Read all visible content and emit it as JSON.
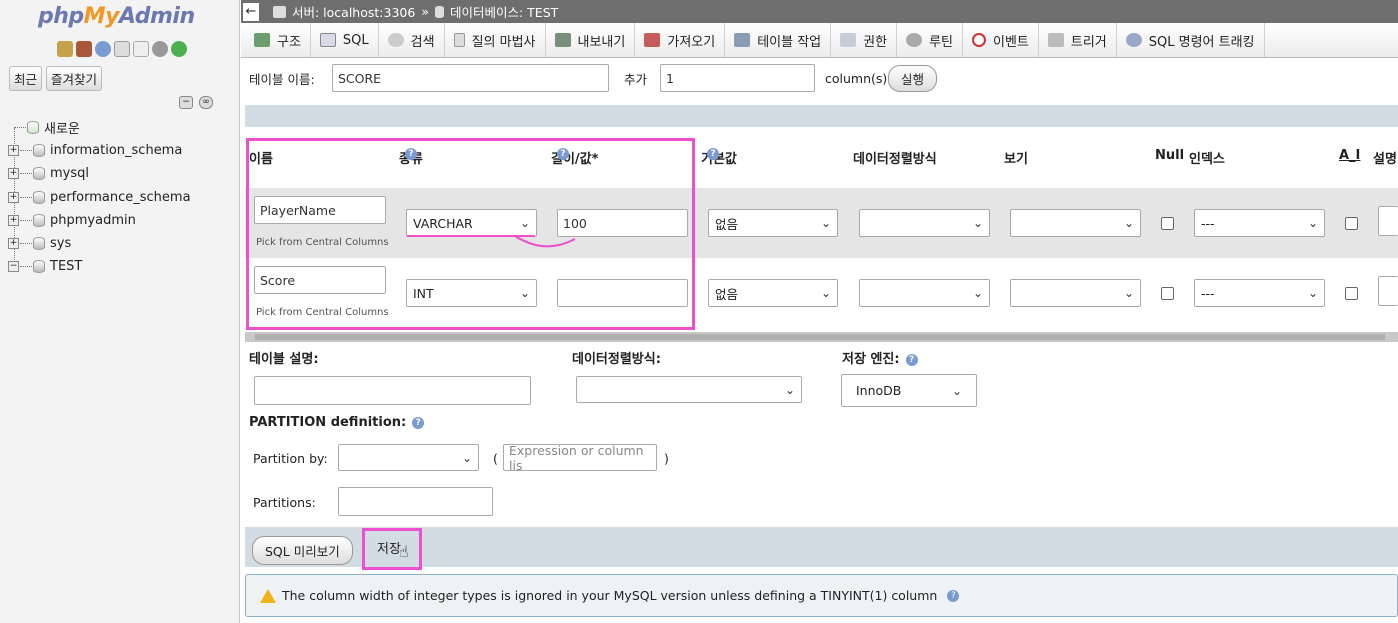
{
  "sidebar": {
    "logo": {
      "php": "php",
      "my": "My",
      "admin": "Admin"
    },
    "tabs": [
      "최근",
      "즐겨찾기"
    ],
    "tree": [
      {
        "label": "새로운",
        "expander": ""
      },
      {
        "label": "information_schema",
        "expander": "+"
      },
      {
        "label": "mysql",
        "expander": "+"
      },
      {
        "label": "performance_schema",
        "expander": "+"
      },
      {
        "label": "phpmyadmin",
        "expander": "+"
      },
      {
        "label": "sys",
        "expander": "+"
      },
      {
        "label": "TEST",
        "expander": "−"
      }
    ]
  },
  "breadcrumb": {
    "back": "←",
    "server": "서버: localhost:3306",
    "sep": "»",
    "database": "데이터베이스: TEST"
  },
  "tabs": [
    "구조",
    "SQL",
    "검색",
    "질의 마법사",
    "내보내기",
    "가져오기",
    "테이블 작업",
    "권한",
    "루틴",
    "이벤트",
    "트리거",
    "SQL 명령어 트래킹"
  ],
  "table_name_row": {
    "label": "테이블 이름:",
    "value": "SCORE",
    "add_label": "추가",
    "add_value": "1",
    "unit": "column(s)",
    "go": "실행"
  },
  "columns_header": [
    "이름",
    "종류",
    "길이/값*",
    "기본값",
    "데이터정렬방식",
    "보기",
    "Null",
    "인덱스",
    "A_I",
    "설명"
  ],
  "rows": [
    {
      "name": "PlayerName",
      "pick": "Pick from Central Columns",
      "type": "VARCHAR",
      "length": "100",
      "default": "없음",
      "collation": "",
      "attributes": "",
      "index": "---"
    },
    {
      "name": "Score",
      "pick": "Pick from Central Columns",
      "type": "INT",
      "length": "",
      "default": "없음",
      "collation": "",
      "attributes": "",
      "index": "---"
    }
  ],
  "table_options": {
    "comment_label": "테이블 설명:",
    "collation_label": "데이터정렬방식:",
    "engine_label": "저장 엔진:",
    "engine_value": "InnoDB",
    "partition_label": "PARTITION definition:",
    "partition_by_label": "Partition by:",
    "expression_placeholder": "Expression or column lis",
    "paren_open": "(",
    "paren_close": ")",
    "partitions_label": "Partitions:"
  },
  "actions": {
    "preview": "SQL 미리보기",
    "save": "저장"
  },
  "notice": "The column width of integer types is ignored in your MySQL version unless defining a TINYINT(1) column",
  "colors": {
    "highlight": "#ee4fcf",
    "band": "#d3dce3",
    "crumb": "#6e6e6e"
  }
}
